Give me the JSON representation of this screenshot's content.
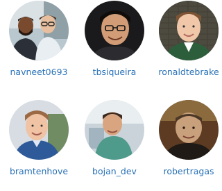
{
  "users": [
    {
      "username": "navneet0693"
    },
    {
      "username": "tbsiqueira"
    },
    {
      "username": "ronaldtebrake"
    },
    {
      "username": "bramtenhove"
    },
    {
      "username": "bojan_dev"
    },
    {
      "username": "robertragas"
    }
  ],
  "colors": {
    "link": "#2a72b8",
    "background": "#ffffff"
  }
}
